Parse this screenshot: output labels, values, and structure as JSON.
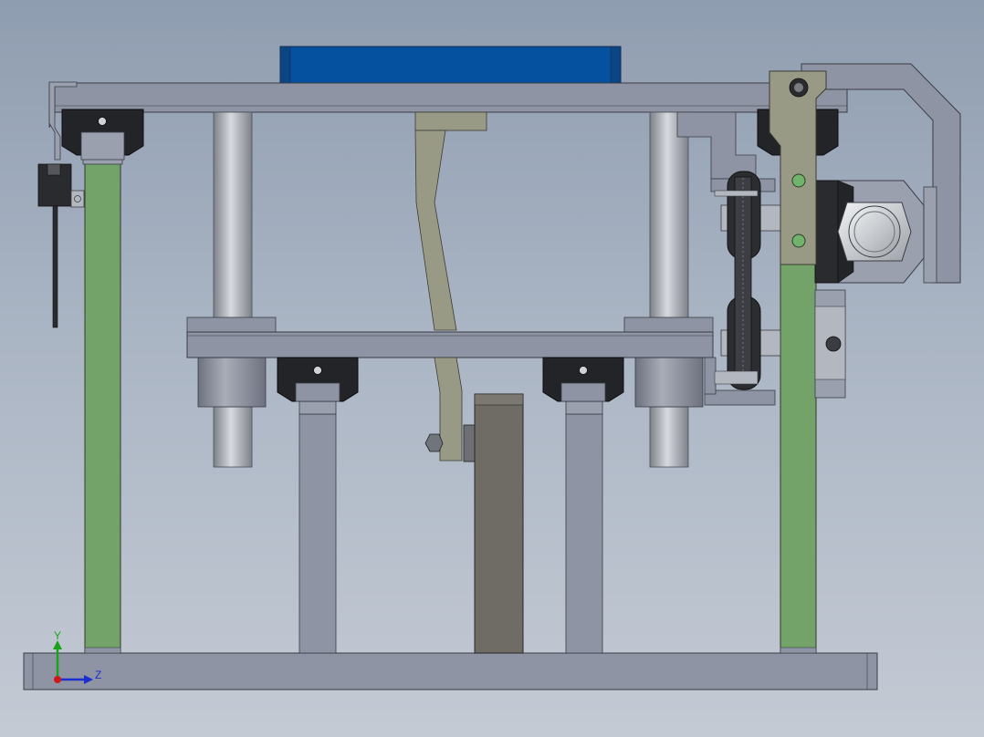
{
  "viewport": {
    "background_top": "#8f9db0",
    "background_bottom": "#c4cad4"
  },
  "colors": {
    "frame_gray": "#8e94a3",
    "frame_edge": "#3a3d45",
    "green_post": "#74a36a",
    "blue_block": "#0650a0",
    "rod_light": "#cfd2d6",
    "rod_dark": "#7c8088",
    "bearing_black": "#232427",
    "plate_dark": "#6f6c66",
    "bracket_olive": "#999a86"
  },
  "triad": {
    "y_label": "Y",
    "z_label": "Z",
    "y_axis_color": "#1aa31a",
    "z_axis_color": "#1b2fd0",
    "origin_color": "#d01818"
  }
}
